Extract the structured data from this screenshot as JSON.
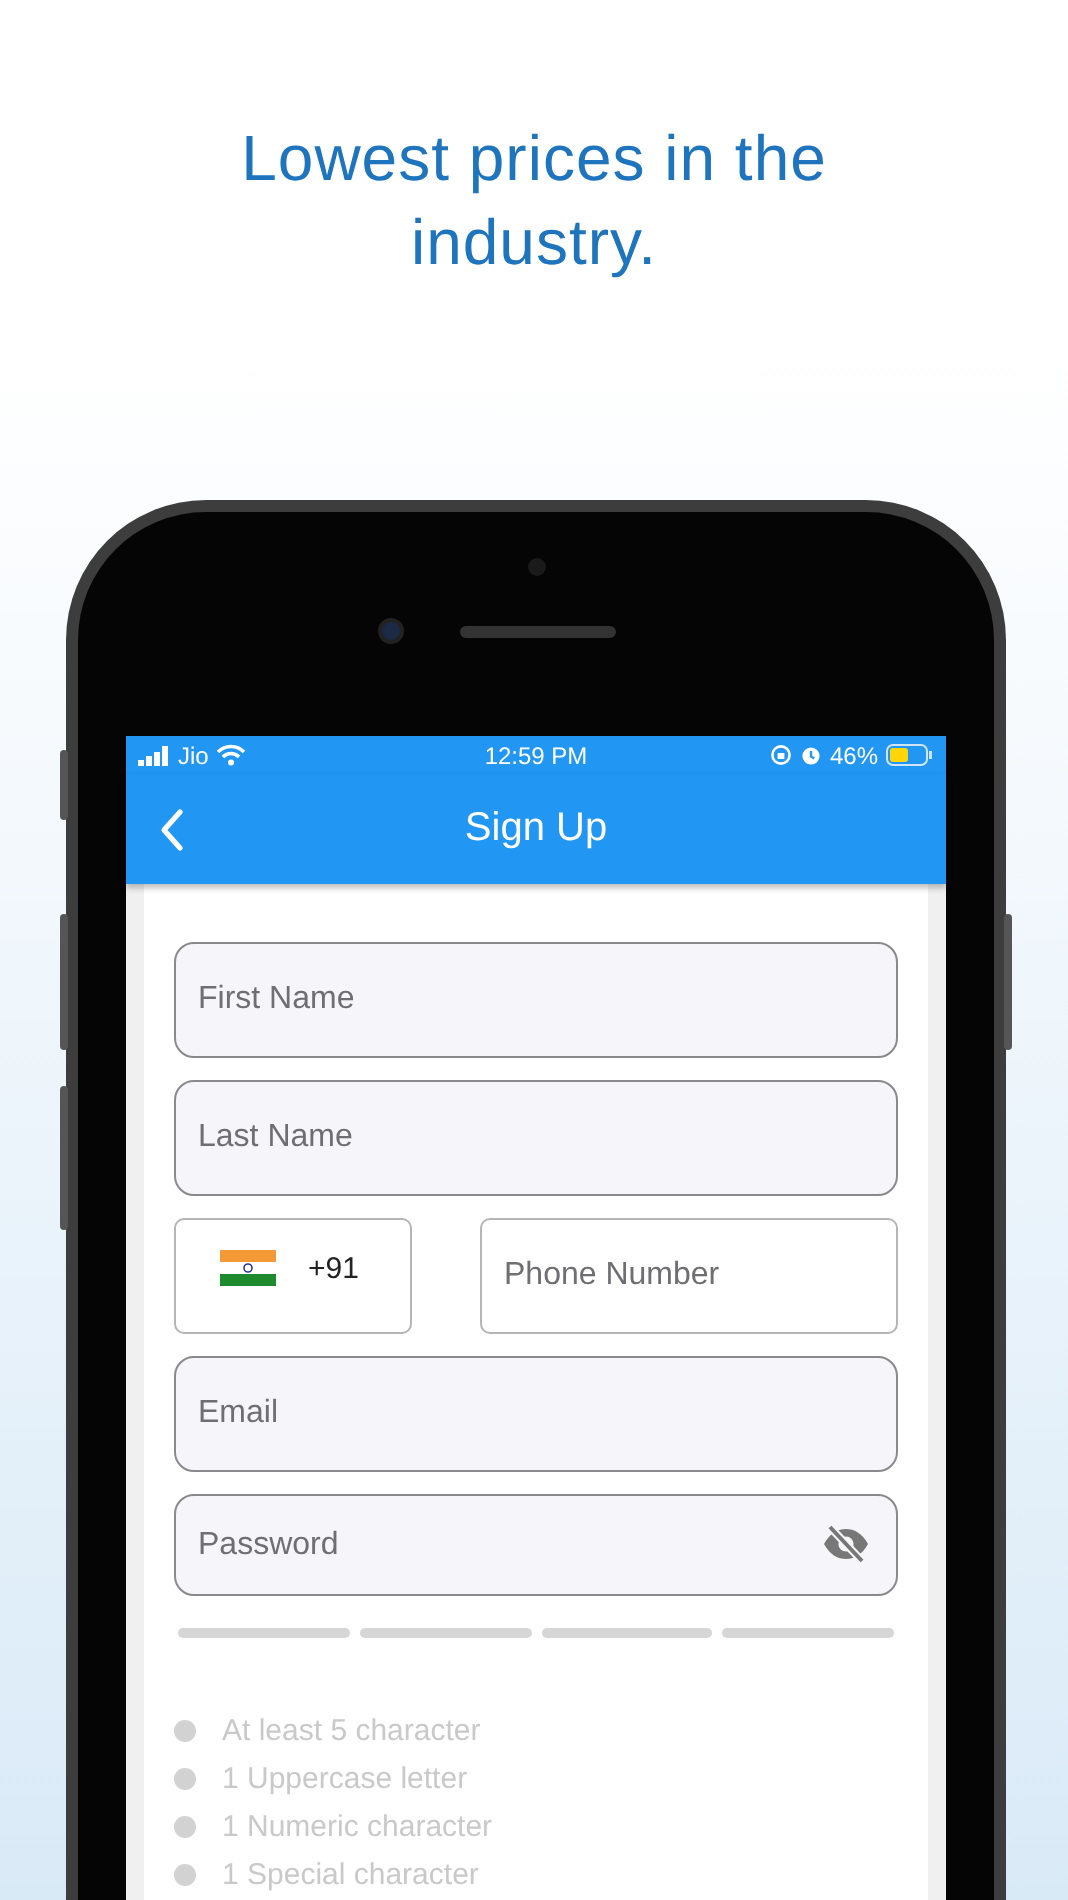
{
  "headline": "Lowest prices in the industry.",
  "status_bar": {
    "carrier": "Jio",
    "time": "12:59 PM",
    "battery": "46%"
  },
  "app_bar": {
    "title": "Sign Up"
  },
  "form": {
    "first_name": {
      "placeholder": "First Name"
    },
    "last_name": {
      "placeholder": "Last Name"
    },
    "country_code": {
      "value": "+91"
    },
    "phone": {
      "placeholder": "Phone Number"
    },
    "email": {
      "placeholder": "Email"
    },
    "password": {
      "placeholder": "Password",
      "visible": false
    },
    "strength_bars": [
      {
        "filled": false
      },
      {
        "filled": false
      },
      {
        "filled": false
      },
      {
        "filled": false
      }
    ],
    "requirements": [
      {
        "text": "At least 5 character",
        "met": false
      },
      {
        "text": "1 Uppercase letter",
        "met": false
      },
      {
        "text": "1 Numeric character",
        "met": false
      },
      {
        "text": "1 Special character",
        "met": false
      }
    ]
  }
}
